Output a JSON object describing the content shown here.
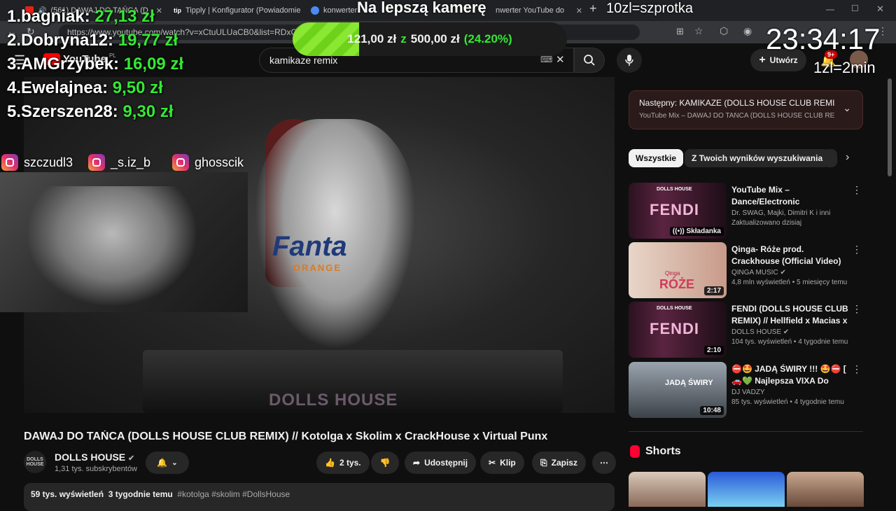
{
  "browser": {
    "tabs": [
      {
        "label": "(561) DAWAJ DO TAŃCA (D"
      },
      {
        "label": "Tipply | Konfigurator (Powiadomie"
      },
      {
        "label": "konwerter"
      },
      {
        "label": "nwerter YouTube do"
      }
    ],
    "tip_favicon": "tip",
    "url": "https://www.youtube.com/watch?v=xCtuULUaCB0&list=RDxCtu...radio=1"
  },
  "overlay": {
    "leaderboard": [
      {
        "rank": "1.",
        "name": "bagniak:",
        "amount": "27,13 zł"
      },
      {
        "rank": "2.",
        "name": "Dobryna12:",
        "amount": "19,77 zł"
      },
      {
        "rank": "3.",
        "name": "AMGrzybek:",
        "amount": "16,09 zł"
      },
      {
        "rank": "4.",
        "name": "Ewelajnea:",
        "amount": "9,50 zł"
      },
      {
        "rank": "5.",
        "name": "Szerszen28:",
        "amount": "9,30 zł"
      }
    ],
    "goal_title": "Na lepszą kamerę",
    "goal_current": "121,00 zł",
    "goal_sep": "z",
    "goal_target": "500,00 zł",
    "goal_percent_label": "(24.20%)",
    "goal_progress": 0.242,
    "fish_text": "10zl=szprotka",
    "clock": "23:34:17",
    "rate": "1zl=2min",
    "instagram": [
      "szczudl3",
      "_s.iz_b",
      "ghosscik"
    ]
  },
  "youtube": {
    "logo": "YouTube",
    "logo_region": "PL",
    "search_value": "kamikaze remix",
    "create_label": "Utwórz",
    "notif_badge": "9+",
    "video": {
      "overlay_logo": "DOLLS HOUSE",
      "shirt_text": "Fanta",
      "shirt_sub": "ORANGE"
    },
    "title": "DAWAJ DO TAŃCA (DOLLS HOUSE CLUB REMIX) // Kotolga x Skolim x CrackHouse x Virtual Punx",
    "channel": {
      "avatar_text": "DOLLS HOUSE",
      "name": "DOLLS HOUSE",
      "subs": "1,31 tys. subskrybentów"
    },
    "actions": {
      "likes": "2 tys.",
      "share": "Udostępnij",
      "clip": "Klip",
      "save": "Zapisz"
    },
    "desc": {
      "views": "59 tys. wyświetleń",
      "time": "3 tygodnie temu",
      "tags": "#kotolga #skolim #DollsHouse"
    },
    "next": {
      "title": "Następny: KAMIKAZE (DOLLS HOUSE CLUB REMIX...",
      "sub": "YouTube Mix – DAWAJ DO TAŃCA (DOLLS HOUSE CLUB RE..."
    },
    "chips": [
      "Wszystkie",
      "Z Twoich wyników wyszukiwania"
    ],
    "recs": [
      {
        "title": "YouTube Mix – Dance/Electronic",
        "channel": "Dr. SWAG, Majki, Dimitri K i inni",
        "meta": "Zaktualizowano dzisiaj",
        "badge": "Składanka",
        "thumb_text": "FENDI",
        "thumb_sub": "DOLLS HOUSE"
      },
      {
        "title": "Qinga- Róże prod. Crackhouse (Official Video)",
        "channel": "QINGA MUSIC",
        "meta": "4,8 mln wyświetleń • 5 miesięcy temu",
        "badge": "2:17",
        "thumb_text": "RÓŻE",
        "thumb_sub": "Qinga"
      },
      {
        "title": "FENDI (DOLLS HOUSE CLUB REMIX) // Hellfield x Macias x ...",
        "channel": "DOLLS HOUSE",
        "meta": "104 tys. wyświetleń • 4 tygodnie temu",
        "badge": "2:10",
        "thumb_text": "FENDI",
        "thumb_sub": "DOLLS HOUSE"
      },
      {
        "title": "⛔🤩 JADĄ ŚWIRY !!! 🤩⛔ [ 🚗💚 Najlepsza VIXA Do Auta...",
        "channel": "DJ VADZY",
        "meta": "85 tys. wyświetleń • 4 tygodnie temu",
        "badge": "10:48",
        "thumb_text": "JADĄ ŚWIRY",
        "thumb_sub": ""
      }
    ],
    "shorts_title": "Shorts"
  }
}
